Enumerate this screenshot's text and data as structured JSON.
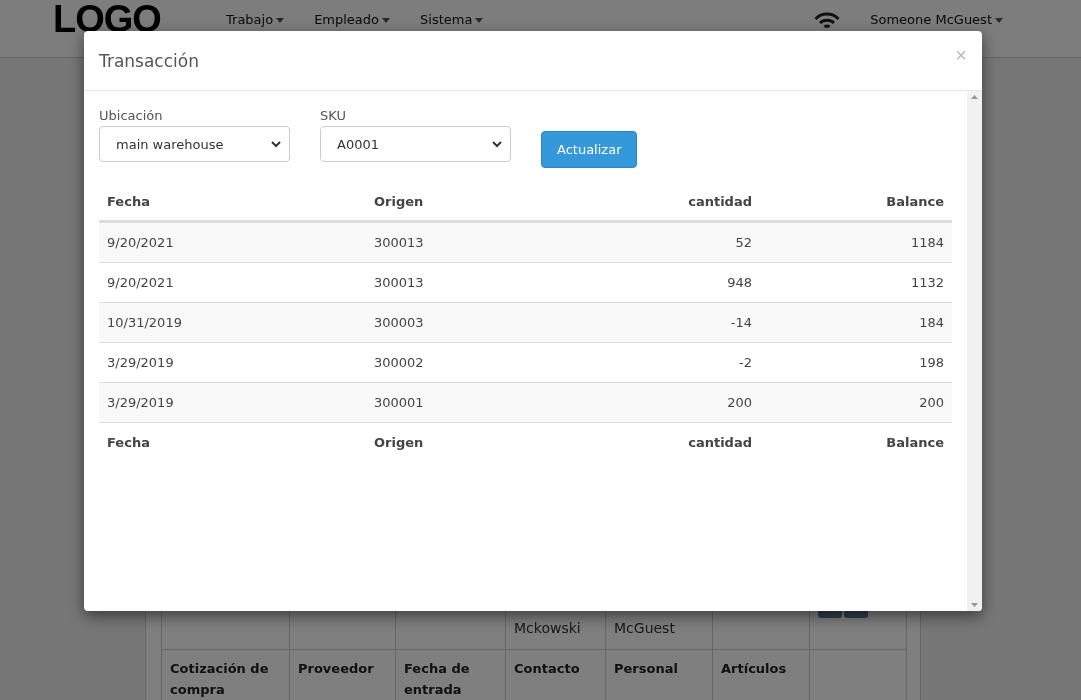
{
  "navbar": {
    "logo": "LOGO",
    "menus": [
      {
        "label": "Trabajo"
      },
      {
        "label": "Empleado"
      },
      {
        "label": "Sistema"
      }
    ],
    "user": "Someone McGuest"
  },
  "background_table": {
    "partial_row": [
      {
        "kind": "empty"
      },
      {
        "kind": "empty"
      },
      {
        "kind": "empty"
      },
      {
        "kind": "text",
        "text": "Mckowski"
      },
      {
        "kind": "text",
        "text": "McGuest"
      },
      {
        "kind": "empty"
      },
      {
        "kind": "actions"
      }
    ],
    "columns": [
      "Cotización de compra",
      "Proveedor",
      "Fecha de entrada",
      "Contacto",
      "Personal",
      "Artículos"
    ]
  },
  "modal": {
    "title": "Transacción",
    "close": "×",
    "filters": [
      {
        "label": "Ubicación",
        "value": "main warehouse"
      },
      {
        "label": "SKU",
        "value": "A0001"
      }
    ],
    "button": "Actualizar",
    "table": {
      "columns": [
        "Fecha",
        "Origen",
        "cantidad",
        "Balance"
      ],
      "rows": [
        [
          "9/20/2021",
          "300013",
          "52",
          "1184"
        ],
        [
          "9/20/2021",
          "300013",
          "948",
          "1132"
        ],
        [
          "10/31/2019",
          "300003",
          "-14",
          "184"
        ],
        [
          "3/29/2019",
          "300002",
          "-2",
          "198"
        ],
        [
          "3/29/2019",
          "300001",
          "200",
          "200"
        ]
      ],
      "footer": [
        "Fecha",
        "Origen",
        "cantidad",
        "Balance"
      ]
    }
  }
}
